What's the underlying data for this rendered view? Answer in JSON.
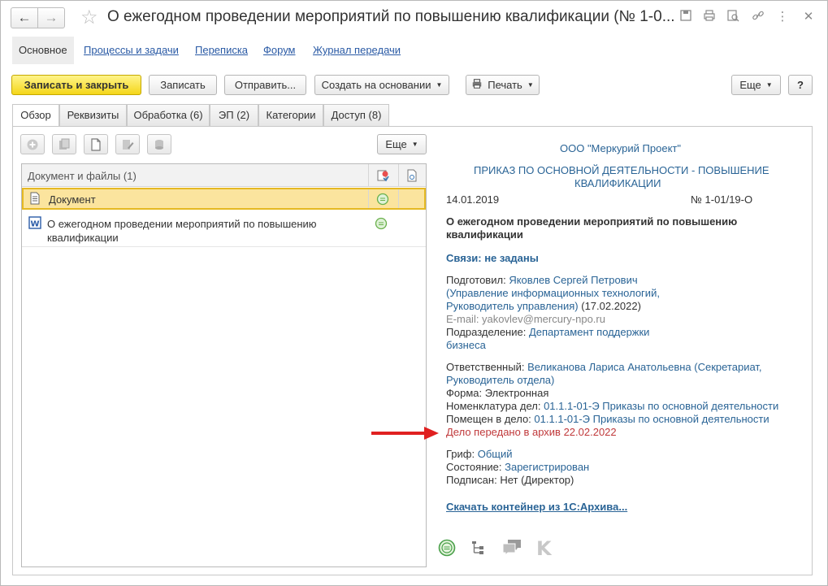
{
  "window": {
    "title": "О ежегодном проведении мероприятий по повышению квалификации (№ 1-0..."
  },
  "sections": {
    "main": "Основное",
    "links": [
      "Процессы и задачи",
      "Переписка",
      "Форум",
      "Журнал передачи"
    ]
  },
  "toolbar": {
    "save_close": "Записать и закрыть",
    "save": "Записать",
    "send": "Отправить...",
    "create_based": "Создать на основании",
    "print": "Печать",
    "more": "Еще",
    "help": "?"
  },
  "tabs": [
    "Обзор",
    "Реквизиты",
    "Обработка (6)",
    "ЭП (2)",
    "Категории",
    "Доступ (8)"
  ],
  "files": {
    "more": "Еще",
    "header": "Документ и файлы (1)",
    "rows": [
      "Документ",
      "О ежегодном проведении мероприятий по повышению",
      "квалификации"
    ]
  },
  "card": {
    "org": "ООО \"Меркурий Проект\"",
    "doc_type_1": "ПРИКАЗ ПО ОСНОВНОЙ ДЕЯТЕЛЬНОСТИ - ПОВЫШЕНИЕ",
    "doc_type_2": "КВАЛИФИКАЦИИ",
    "date": "14.01.2019",
    "number": "№ 1-01/19-О",
    "subject_1": "О ежегодном проведении мероприятий по повышению",
    "subject_2": "квалификации",
    "links": "Связи: не заданы",
    "prepared_label": "Подготовил:",
    "prepared_name": "Яковлев Сергей Петрович",
    "prepared_dept_1": "(Управление информационных технологий,",
    "prepared_dept_2": "Руководитель управления)",
    "prepared_date": "(17.02.2022)",
    "email": "E-mail: yakovlev@mercury-npo.ru",
    "division_label": "Подразделение:",
    "division_1": "Департамент поддержки",
    "division_2": "бизнеса",
    "resp_label": "Ответственный:",
    "resp_1": "Великанова Лариса Анатольевна (Секретариат,",
    "resp_2": "Руководитель отдела)",
    "form_label": "Форма:",
    "form_value": "Электронная",
    "nomen_label": "Номенклатура дел:",
    "nomen_value": "01.1.1-01-Э Приказы по основной деятельности",
    "placed_label": "Помещен в дело:",
    "placed_value": "01.1.1-01-Э Приказы по основной деятельности",
    "archive": "Дело передано в архив 22.02.2022",
    "grif_label": "Гриф:",
    "grif_value": "Общий",
    "state_label": "Состояние:",
    "state_value": "Зарегистрирован",
    "signed_label": "Подписан:",
    "signed_value": "Нет (Директор)",
    "download": "Скачать контейнер из 1С:Архива..."
  },
  "colors": {
    "accent_yellow": "#f4d61a",
    "link_blue": "#2a6496",
    "archive_red": "#c0393b",
    "arrow_red": "#e02020"
  }
}
